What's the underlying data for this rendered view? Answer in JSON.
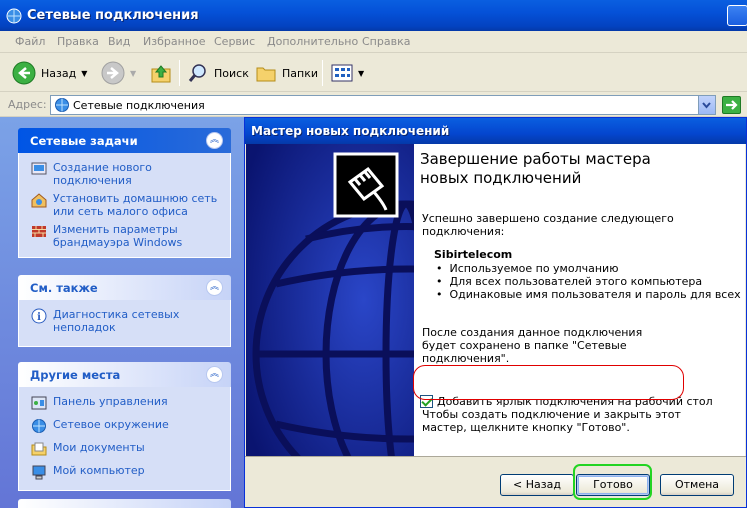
{
  "window": {
    "title": "Сетевые подключения"
  },
  "menu": [
    "Файл",
    "Правка",
    "Вид",
    "Избранное",
    "Сервис",
    "Дополнительно",
    "Справка"
  ],
  "toolbar": {
    "back_label": "Назад",
    "search_label": "Поиск",
    "folders_label": "Папки"
  },
  "address": {
    "label": "Адрес:",
    "value": "Сетевые подключения"
  },
  "taskpane": {
    "panels": [
      {
        "title": "Сетевые задачи",
        "items": [
          {
            "label": "Создание нового подключения",
            "icon": "new-connection-icon"
          },
          {
            "label": "Установить домашнюю сеть или сеть малого офиса",
            "icon": "home-network-icon"
          },
          {
            "label": "Изменить параметры брандмауэра Windows",
            "icon": "firewall-icon"
          }
        ]
      },
      {
        "title": "См. также",
        "items": [
          {
            "label": "Диагностика сетевых неполадок",
            "icon": "info-icon"
          }
        ]
      },
      {
        "title": "Другие места",
        "items": [
          {
            "label": "Панель управления",
            "icon": "control-panel-icon"
          },
          {
            "label": "Сетевое окружение",
            "icon": "network-places-icon"
          },
          {
            "label": "Мои документы",
            "icon": "my-documents-icon"
          },
          {
            "label": "Мой компьютер",
            "icon": "my-computer-icon"
          }
        ]
      }
    ]
  },
  "wizard": {
    "title": "Мастер новых подключений",
    "heading": "Завершение работы мастера новых подключений",
    "success_text": "Успешно завершено создание следующего подключения:",
    "connection_name": "Sibirtelecom",
    "bullets": [
      "Используемое по умолчанию",
      "Для всех пользователей этого компьютера",
      "Одинаковые имя пользователя и пароль для всех"
    ],
    "saved_text": "После создания данное подключения будет сохранено в папке \"Сетевые подключения\".",
    "shortcut_checkbox_label": "Добавить ярлык подключения на рабочий стол",
    "shortcut_checked": true,
    "finish_hint": "Чтобы создать подключение и закрыть этот мастер, щелкните кнопку \"Готово\".",
    "buttons": {
      "back": "< Назад",
      "finish": "Готово",
      "cancel": "Отмена"
    }
  },
  "colors": {
    "xp_blue": "#0551d8",
    "taskpane_link": "#215dc6",
    "highlight_red": "#e00000",
    "highlight_green": "#22d422"
  }
}
